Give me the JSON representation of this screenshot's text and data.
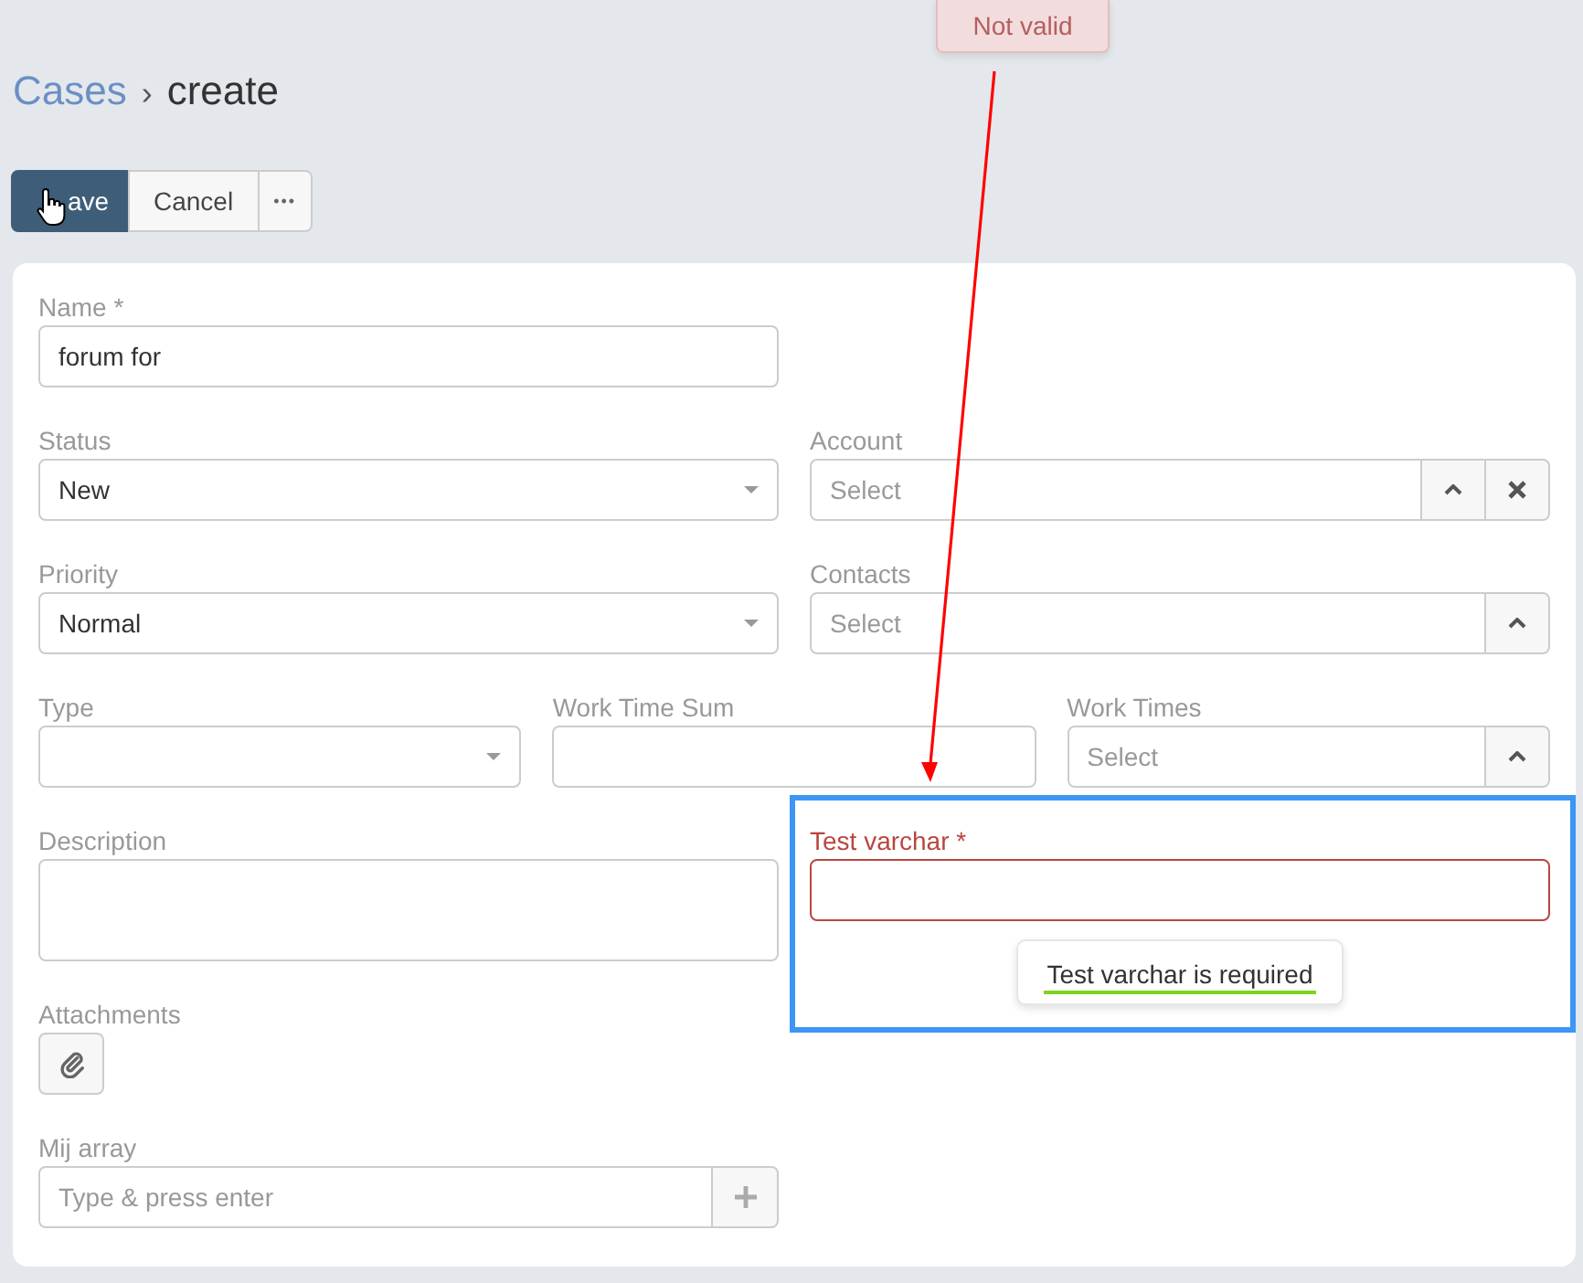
{
  "breadcrumb": {
    "parent": "Cases",
    "separator": "›",
    "current": "create"
  },
  "toolbar": [
    {
      "label": "ave",
      "kind": "primary",
      "hovered": true
    },
    {
      "label": "Cancel",
      "kind": "default",
      "hovered": false
    },
    {
      "label": "•••",
      "kind": "more",
      "hovered": false
    }
  ],
  "annotation": {
    "note": "Not valid"
  },
  "rows": [
    {
      "columns": [
        [
          {
            "label": "Name *",
            "kind": "text",
            "value": "forum for"
          }
        ]
      ]
    },
    {
      "columns": [
        [
          {
            "label": "Status",
            "kind": "select",
            "value": "New"
          }
        ],
        [
          {
            "label": "Account",
            "kind": "lookup",
            "placeholder": "Select",
            "clearable": true
          }
        ]
      ]
    },
    {
      "columns": [
        [
          {
            "label": "Priority",
            "kind": "select",
            "value": "Normal"
          }
        ],
        [
          {
            "label": "Contacts",
            "kind": "lookup",
            "placeholder": "Select",
            "clearable": false
          }
        ]
      ]
    },
    {
      "columns": [
        [
          {
            "label": "Type",
            "kind": "select"
          }
        ],
        [
          {
            "label": "Work Time Sum",
            "kind": "text"
          }
        ],
        [
          {
            "label": "Work Times",
            "kind": "lookup",
            "placeholder": "Select",
            "clearable": false
          }
        ]
      ]
    },
    {
      "columns": [
        [
          {
            "label": "Description",
            "kind": "textarea"
          },
          {
            "label": "Attachments",
            "kind": "attach"
          },
          {
            "label": "Mij array",
            "kind": "tags",
            "placeholder": "Type & press enter"
          }
        ],
        [
          {
            "label": "Test varchar *",
            "kind": "text",
            "invalid": true,
            "error": "Test varchar is required",
            "highlighted": true
          }
        ]
      ]
    }
  ]
}
